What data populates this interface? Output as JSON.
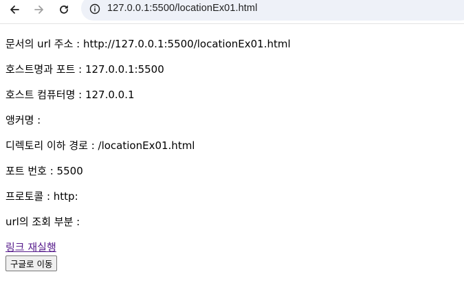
{
  "browser": {
    "url": "127.0.0.1:5500/locationEx01.html",
    "icons": {
      "back": "arrow-left-icon",
      "forward": "arrow-right-icon",
      "reload": "reload-icon",
      "site_info": "info-circle-icon"
    }
  },
  "page": {
    "lines": [
      "문서의 url 주소 : http://127.0.0.1:5500/locationEx01.html",
      "호스트명과 포트 : 127.0.0.1:5500",
      "호스트 컴퓨터명 : 127.0.0.1",
      "앵커명 :",
      "디렉토리 이하 경로 : /locationEx01.html",
      "포트 번호 : 5500",
      "프로토콜 : http:",
      "url의 조회 부분 :"
    ],
    "link_label": "링크 재실행",
    "button_label": "구글로 이동"
  },
  "colors": {
    "link_visited": "#551a8b",
    "omnibox_bg": "#eef1f8"
  }
}
